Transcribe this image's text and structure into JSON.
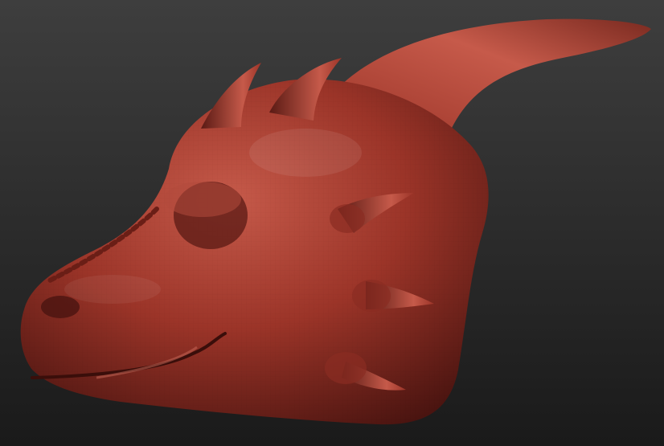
{
  "viewport": {
    "background_top": "#3e3e3e",
    "background_bottom": "#1a1a1a"
  },
  "model": {
    "subject": "dragon-head-sculpt",
    "material_base": "#9b3428",
    "material_highlight": "#c65a4a",
    "material_shadow": "#4a1410"
  }
}
